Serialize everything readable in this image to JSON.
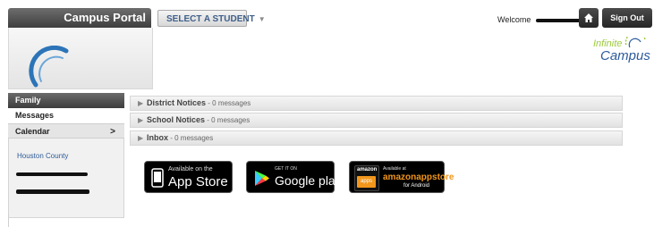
{
  "header": {
    "brand_title": "Campus Portal",
    "select_student_label": "SELECT A STUDENT",
    "welcome_label": "Welcome",
    "signout_label": "Sign Out",
    "logo_top": "Infinite",
    "logo_bottom": "Campus"
  },
  "sidebar": {
    "items": [
      {
        "label": "Family"
      },
      {
        "label": "Messages"
      },
      {
        "label": "Calendar",
        "chevron": ">"
      }
    ],
    "school_link": "Houston County"
  },
  "notices": [
    {
      "title": "District Notices",
      "count": " - 0 messages"
    },
    {
      "title": "School Notices",
      "count": " - 0 messages"
    },
    {
      "title": "Inbox",
      "count": " - 0 messages"
    }
  ],
  "badges": {
    "apple": {
      "small": "Available on the",
      "big": "App Store"
    },
    "google": {
      "small": "GET IT ON",
      "big": "Google play"
    },
    "amazon": {
      "small": "Available at",
      "big": "amazonappstore",
      "sub": "for Android",
      "logo": "amazon",
      "logo_sub": "apps"
    }
  },
  "icons": [
    "home-icon",
    "caret-down-icon",
    "chevron-right-icon",
    "arrow-right-icon",
    "apple-icon",
    "google-play-icon",
    "amazon-apps-icon"
  ],
  "colors": {
    "brand_dark": "#3f3f3f",
    "link_blue": "#2e5a96",
    "logo_green": "#9ccb3b",
    "logo_blue": "#2c5b9c"
  }
}
